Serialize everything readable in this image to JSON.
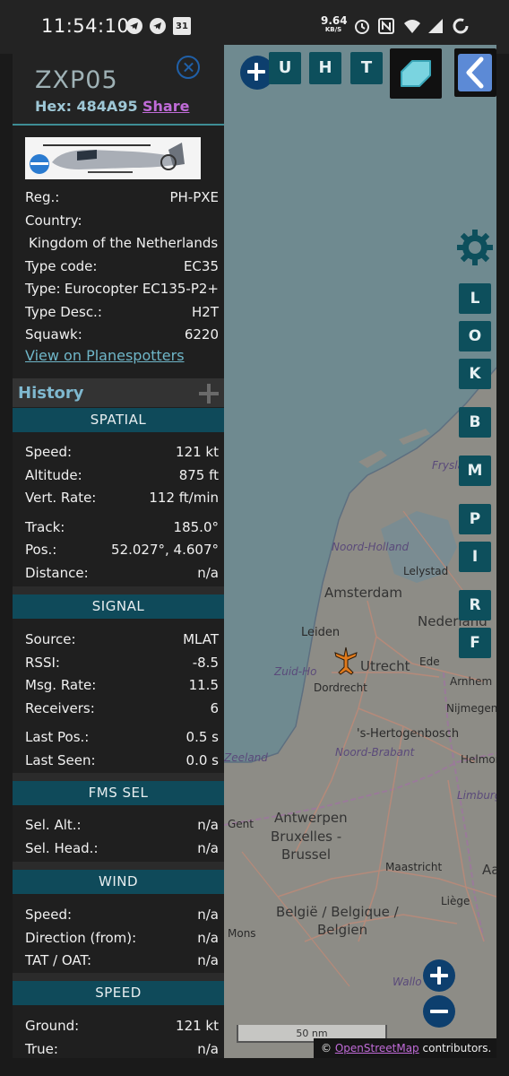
{
  "status_bar": {
    "time": "11:54:10",
    "net_speed_value": "9.64",
    "net_speed_unit": "KB/S",
    "calendar_day": "31",
    "icons": [
      "telegram-icon",
      "telegram-icon",
      "calendar-icon",
      "alarm-icon",
      "nfc-icon",
      "wifi-icon",
      "sync-icon"
    ]
  },
  "aircraft": {
    "callsign": "ZXP05",
    "hex_label": "Hex: 484A95",
    "share_label": "Share",
    "details": [
      {
        "key": "Reg.:",
        "value": "PH-PXE"
      },
      {
        "key": "Country:",
        "value": ""
      },
      {
        "key": "",
        "value": "Kingdom of the Netherlands",
        "full": true
      },
      {
        "key": "Type code:",
        "value": "EC35"
      },
      {
        "key": "Type:",
        "value": "Eurocopter EC135-P2+"
      },
      {
        "key": "Type Desc.:",
        "value": "H2T"
      },
      {
        "key": "Squawk:",
        "value": "6220"
      }
    ],
    "planespotters_link": "View on Planespotters"
  },
  "history": {
    "title": "History"
  },
  "sections": {
    "spatial": {
      "title": "SPATIAL",
      "rows": [
        {
          "key": "Speed:",
          "value": "121 kt"
        },
        {
          "key": "Altitude:",
          "value": "875 ft"
        },
        {
          "key": "Vert. Rate:",
          "value": "112 ft/min"
        },
        {
          "key": "Track:",
          "value": "185.0°"
        },
        {
          "key": "Pos.:",
          "value": "52.027°, 4.607°"
        },
        {
          "key": "Distance:",
          "value": "n/a"
        }
      ]
    },
    "signal": {
      "title": "SIGNAL",
      "rows": [
        {
          "key": "Source:",
          "value": "MLAT"
        },
        {
          "key": "RSSI:",
          "value": "-8.5"
        },
        {
          "key": "Msg. Rate:",
          "value": "11.5"
        },
        {
          "key": "Receivers:",
          "value": "6"
        },
        {
          "key": "Last Pos.:",
          "value": "0.5 s"
        },
        {
          "key": "Last Seen:",
          "value": "0.0 s"
        }
      ]
    },
    "fms": {
      "title": "FMS SEL",
      "rows": [
        {
          "key": "Sel. Alt.:",
          "value": "n/a"
        },
        {
          "key": "Sel. Head.:",
          "value": "n/a"
        }
      ]
    },
    "wind": {
      "title": "WIND",
      "rows": [
        {
          "key": "Speed:",
          "value": "n/a"
        },
        {
          "key": "Direction (from):",
          "value": "n/a"
        },
        {
          "key": "TAT / OAT:",
          "value": "n/a"
        }
      ]
    },
    "speed": {
      "title": "SPEED",
      "rows": [
        {
          "key": "Ground:",
          "value": "121 kt"
        },
        {
          "key": "True:",
          "value": "n/a"
        }
      ]
    }
  },
  "map": {
    "top_buttons": [
      "U",
      "H",
      "T"
    ],
    "side_buttons": [
      "L",
      "O",
      "K",
      "B",
      "M",
      "P",
      "I",
      "R",
      "F"
    ],
    "scale_label": "50 nm",
    "attribution_prefix": "©",
    "attribution_link": "OpenStreetMap",
    "attribution_suffix": "contributors.",
    "labels": {
      "amsterdam": "Amsterdam",
      "noord_holland": "Noord-Holland",
      "lelystad": "Lelystad",
      "nederland": "Nederland",
      "leiden": "Leiden",
      "zuid_holland": "Zuid-Ho",
      "utrecht": "Utrecht",
      "ede": "Ede",
      "arnhem": "Arnhem",
      "dordrecht": "Dordrecht",
      "nijmegen": "Nijmegen",
      "hertogenbosch": "'s-Hertogenbosch",
      "noord_brabant": "Noord-Brabant",
      "zeeland": "Zeeland",
      "helmond": "Helmond",
      "limburg": "Limburg",
      "gent": "Gent",
      "antwerpen": "Antwerpen",
      "bruxelles": "Bruxelles -",
      "brussel": "Brussel",
      "maastricht": "Maastricht",
      "aach": "Aac",
      "liege": "Liège",
      "belgie1": "België / Belgique /",
      "belgie2": "Belgien",
      "mons": "Mons",
      "friesland": "Fryslân",
      "wallonie": "Wallo"
    },
    "colors": {
      "sea": "#6f8a90",
      "land": "#8c8b85",
      "panel_section": "#0f4a5a",
      "button": "#0d4f5c",
      "aircraft": "#e07a1c",
      "link_purple": "#c06bd8"
    }
  }
}
